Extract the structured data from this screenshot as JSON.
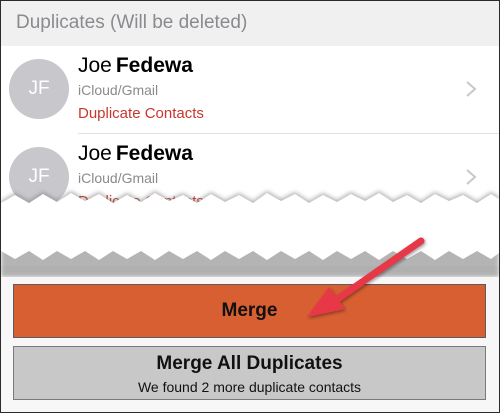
{
  "section": {
    "title": "Duplicates (Will be deleted)"
  },
  "contacts": [
    {
      "initials": "JF",
      "first_name": "Joe",
      "last_name": "Fedewa",
      "source": "iCloud/Gmail",
      "status": "Duplicate Contacts"
    },
    {
      "initials": "JF",
      "first_name": "Joe",
      "last_name": "Fedewa",
      "source": "iCloud/Gmail",
      "status": "Duplicate Contacts"
    }
  ],
  "actions": {
    "merge_label": "Merge",
    "merge_all_label": "Merge All Duplicates",
    "merge_all_subtitle": "We found 2 more duplicate contacts"
  },
  "colors": {
    "merge_button": "#d85f32",
    "duplicate_text": "#c9362d",
    "annotation_arrow": "#e63946",
    "merge_all_button": "#c8c8c8"
  },
  "icons": {
    "row_chevron": "chevron-right-icon",
    "annotation": "arrow-pointer-icon"
  }
}
